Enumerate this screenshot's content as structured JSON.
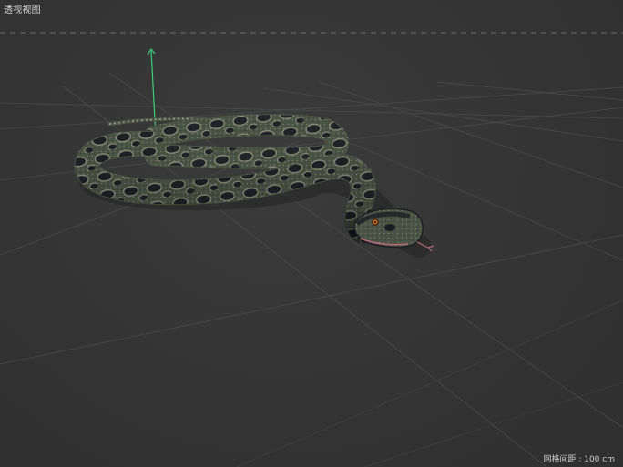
{
  "viewport": {
    "label": "透视视图",
    "grid_spacing_label": "网格间距",
    "grid_spacing_value": "100 cm"
  },
  "scene": {
    "object": "snake-model",
    "gizmo_axis": "y-axis",
    "colors": {
      "background": "#353535",
      "grid_line": "#4a4a4a",
      "horizon": "#6b6b6b",
      "axis_y": "#3fd07a",
      "snake_body": "#4b5345",
      "snake_spot": "#1b1e24",
      "tongue": "#b56a7a",
      "eye": "#c9651f"
    }
  }
}
